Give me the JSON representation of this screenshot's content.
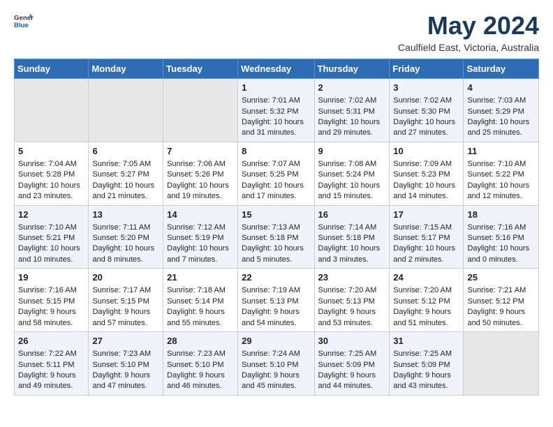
{
  "header": {
    "logo_general": "General",
    "logo_blue": "Blue",
    "month_title": "May 2024",
    "location": "Caulfield East, Victoria, Australia"
  },
  "days_of_week": [
    "Sunday",
    "Monday",
    "Tuesday",
    "Wednesday",
    "Thursday",
    "Friday",
    "Saturday"
  ],
  "weeks": [
    [
      {
        "day": "",
        "sunrise": "",
        "sunset": "",
        "daylight": "",
        "empty": true
      },
      {
        "day": "",
        "sunrise": "",
        "sunset": "",
        "daylight": "",
        "empty": true
      },
      {
        "day": "",
        "sunrise": "",
        "sunset": "",
        "daylight": "",
        "empty": true
      },
      {
        "day": "1",
        "sunrise": "Sunrise: 7:01 AM",
        "sunset": "Sunset: 5:32 PM",
        "daylight": "Daylight: 10 hours and 31 minutes."
      },
      {
        "day": "2",
        "sunrise": "Sunrise: 7:02 AM",
        "sunset": "Sunset: 5:31 PM",
        "daylight": "Daylight: 10 hours and 29 minutes."
      },
      {
        "day": "3",
        "sunrise": "Sunrise: 7:02 AM",
        "sunset": "Sunset: 5:30 PM",
        "daylight": "Daylight: 10 hours and 27 minutes."
      },
      {
        "day": "4",
        "sunrise": "Sunrise: 7:03 AM",
        "sunset": "Sunset: 5:29 PM",
        "daylight": "Daylight: 10 hours and 25 minutes."
      }
    ],
    [
      {
        "day": "5",
        "sunrise": "Sunrise: 7:04 AM",
        "sunset": "Sunset: 5:28 PM",
        "daylight": "Daylight: 10 hours and 23 minutes."
      },
      {
        "day": "6",
        "sunrise": "Sunrise: 7:05 AM",
        "sunset": "Sunset: 5:27 PM",
        "daylight": "Daylight: 10 hours and 21 minutes."
      },
      {
        "day": "7",
        "sunrise": "Sunrise: 7:06 AM",
        "sunset": "Sunset: 5:26 PM",
        "daylight": "Daylight: 10 hours and 19 minutes."
      },
      {
        "day": "8",
        "sunrise": "Sunrise: 7:07 AM",
        "sunset": "Sunset: 5:25 PM",
        "daylight": "Daylight: 10 hours and 17 minutes."
      },
      {
        "day": "9",
        "sunrise": "Sunrise: 7:08 AM",
        "sunset": "Sunset: 5:24 PM",
        "daylight": "Daylight: 10 hours and 15 minutes."
      },
      {
        "day": "10",
        "sunrise": "Sunrise: 7:09 AM",
        "sunset": "Sunset: 5:23 PM",
        "daylight": "Daylight: 10 hours and 14 minutes."
      },
      {
        "day": "11",
        "sunrise": "Sunrise: 7:10 AM",
        "sunset": "Sunset: 5:22 PM",
        "daylight": "Daylight: 10 hours and 12 minutes."
      }
    ],
    [
      {
        "day": "12",
        "sunrise": "Sunrise: 7:10 AM",
        "sunset": "Sunset: 5:21 PM",
        "daylight": "Daylight: 10 hours and 10 minutes."
      },
      {
        "day": "13",
        "sunrise": "Sunrise: 7:11 AM",
        "sunset": "Sunset: 5:20 PM",
        "daylight": "Daylight: 10 hours and 8 minutes."
      },
      {
        "day": "14",
        "sunrise": "Sunrise: 7:12 AM",
        "sunset": "Sunset: 5:19 PM",
        "daylight": "Daylight: 10 hours and 7 minutes."
      },
      {
        "day": "15",
        "sunrise": "Sunrise: 7:13 AM",
        "sunset": "Sunset: 5:18 PM",
        "daylight": "Daylight: 10 hours and 5 minutes."
      },
      {
        "day": "16",
        "sunrise": "Sunrise: 7:14 AM",
        "sunset": "Sunset: 5:18 PM",
        "daylight": "Daylight: 10 hours and 3 minutes."
      },
      {
        "day": "17",
        "sunrise": "Sunrise: 7:15 AM",
        "sunset": "Sunset: 5:17 PM",
        "daylight": "Daylight: 10 hours and 2 minutes."
      },
      {
        "day": "18",
        "sunrise": "Sunrise: 7:16 AM",
        "sunset": "Sunset: 5:16 PM",
        "daylight": "Daylight: 10 hours and 0 minutes."
      }
    ],
    [
      {
        "day": "19",
        "sunrise": "Sunrise: 7:16 AM",
        "sunset": "Sunset: 5:15 PM",
        "daylight": "Daylight: 9 hours and 58 minutes."
      },
      {
        "day": "20",
        "sunrise": "Sunrise: 7:17 AM",
        "sunset": "Sunset: 5:15 PM",
        "daylight": "Daylight: 9 hours and 57 minutes."
      },
      {
        "day": "21",
        "sunrise": "Sunrise: 7:18 AM",
        "sunset": "Sunset: 5:14 PM",
        "daylight": "Daylight: 9 hours and 55 minutes."
      },
      {
        "day": "22",
        "sunrise": "Sunrise: 7:19 AM",
        "sunset": "Sunset: 5:13 PM",
        "daylight": "Daylight: 9 hours and 54 minutes."
      },
      {
        "day": "23",
        "sunrise": "Sunrise: 7:20 AM",
        "sunset": "Sunset: 5:13 PM",
        "daylight": "Daylight: 9 hours and 53 minutes."
      },
      {
        "day": "24",
        "sunrise": "Sunrise: 7:20 AM",
        "sunset": "Sunset: 5:12 PM",
        "daylight": "Daylight: 9 hours and 51 minutes."
      },
      {
        "day": "25",
        "sunrise": "Sunrise: 7:21 AM",
        "sunset": "Sunset: 5:12 PM",
        "daylight": "Daylight: 9 hours and 50 minutes."
      }
    ],
    [
      {
        "day": "26",
        "sunrise": "Sunrise: 7:22 AM",
        "sunset": "Sunset: 5:11 PM",
        "daylight": "Daylight: 9 hours and 49 minutes."
      },
      {
        "day": "27",
        "sunrise": "Sunrise: 7:23 AM",
        "sunset": "Sunset: 5:10 PM",
        "daylight": "Daylight: 9 hours and 47 minutes."
      },
      {
        "day": "28",
        "sunrise": "Sunrise: 7:23 AM",
        "sunset": "Sunset: 5:10 PM",
        "daylight": "Daylight: 9 hours and 46 minutes."
      },
      {
        "day": "29",
        "sunrise": "Sunrise: 7:24 AM",
        "sunset": "Sunset: 5:10 PM",
        "daylight": "Daylight: 9 hours and 45 minutes."
      },
      {
        "day": "30",
        "sunrise": "Sunrise: 7:25 AM",
        "sunset": "Sunset: 5:09 PM",
        "daylight": "Daylight: 9 hours and 44 minutes."
      },
      {
        "day": "31",
        "sunrise": "Sunrise: 7:25 AM",
        "sunset": "Sunset: 5:09 PM",
        "daylight": "Daylight: 9 hours and 43 minutes."
      },
      {
        "day": "",
        "sunrise": "",
        "sunset": "",
        "daylight": "",
        "empty": true
      }
    ]
  ]
}
